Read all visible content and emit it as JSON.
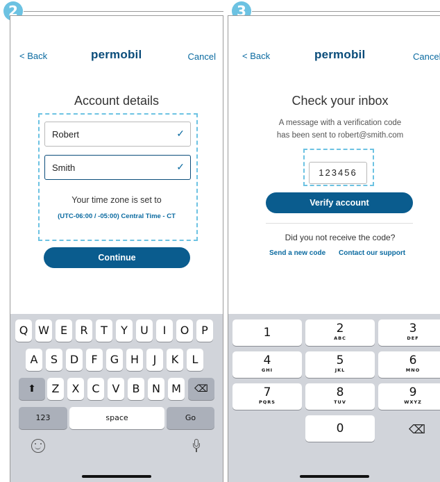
{
  "steps": [
    "2",
    "3"
  ],
  "accent": "#6cc2e2",
  "brand_color": "#0a5c8e",
  "screen_account": {
    "nav": {
      "back": "< Back",
      "logo": "permobil",
      "cancel": "Cancel"
    },
    "title": "Account details",
    "first_name": "Robert",
    "last_name": "Smith",
    "timezone_label": "Your time zone is set to",
    "timezone_value": "(UTC-06:00 / -05:00) Central Time - CT",
    "continue_label": "Continue",
    "keyboard": {
      "row1": [
        "Q",
        "W",
        "E",
        "R",
        "T",
        "Y",
        "U",
        "I",
        "O",
        "P"
      ],
      "row2": [
        "A",
        "S",
        "D",
        "F",
        "G",
        "H",
        "J",
        "K",
        "L"
      ],
      "row3": [
        "Z",
        "X",
        "C",
        "V",
        "B",
        "N",
        "M"
      ],
      "numbers_key": "123",
      "space_key": "space",
      "go_key": "Go"
    }
  },
  "screen_inbox": {
    "nav": {
      "back": "< Back",
      "logo": "permobil",
      "cancel": "Cancel"
    },
    "title": "Check your inbox",
    "message_line1": "A message with a verification code",
    "message_line2": "has been sent to robert@smith.com",
    "code": "123456",
    "verify_label": "Verify account",
    "not_received": "Did you not receive the code?",
    "send_new_code": "Send a new code",
    "contact_support": "Contact our support",
    "numpad": [
      {
        "digit": "1",
        "letters": ""
      },
      {
        "digit": "2",
        "letters": "ABC"
      },
      {
        "digit": "3",
        "letters": "DEF"
      },
      {
        "digit": "4",
        "letters": "GHI"
      },
      {
        "digit": "5",
        "letters": "JKL"
      },
      {
        "digit": "6",
        "letters": "MNO"
      },
      {
        "digit": "7",
        "letters": "PQRS"
      },
      {
        "digit": "8",
        "letters": "TUV"
      },
      {
        "digit": "9",
        "letters": "WXYZ"
      },
      {
        "digit": "0",
        "letters": ""
      }
    ]
  }
}
